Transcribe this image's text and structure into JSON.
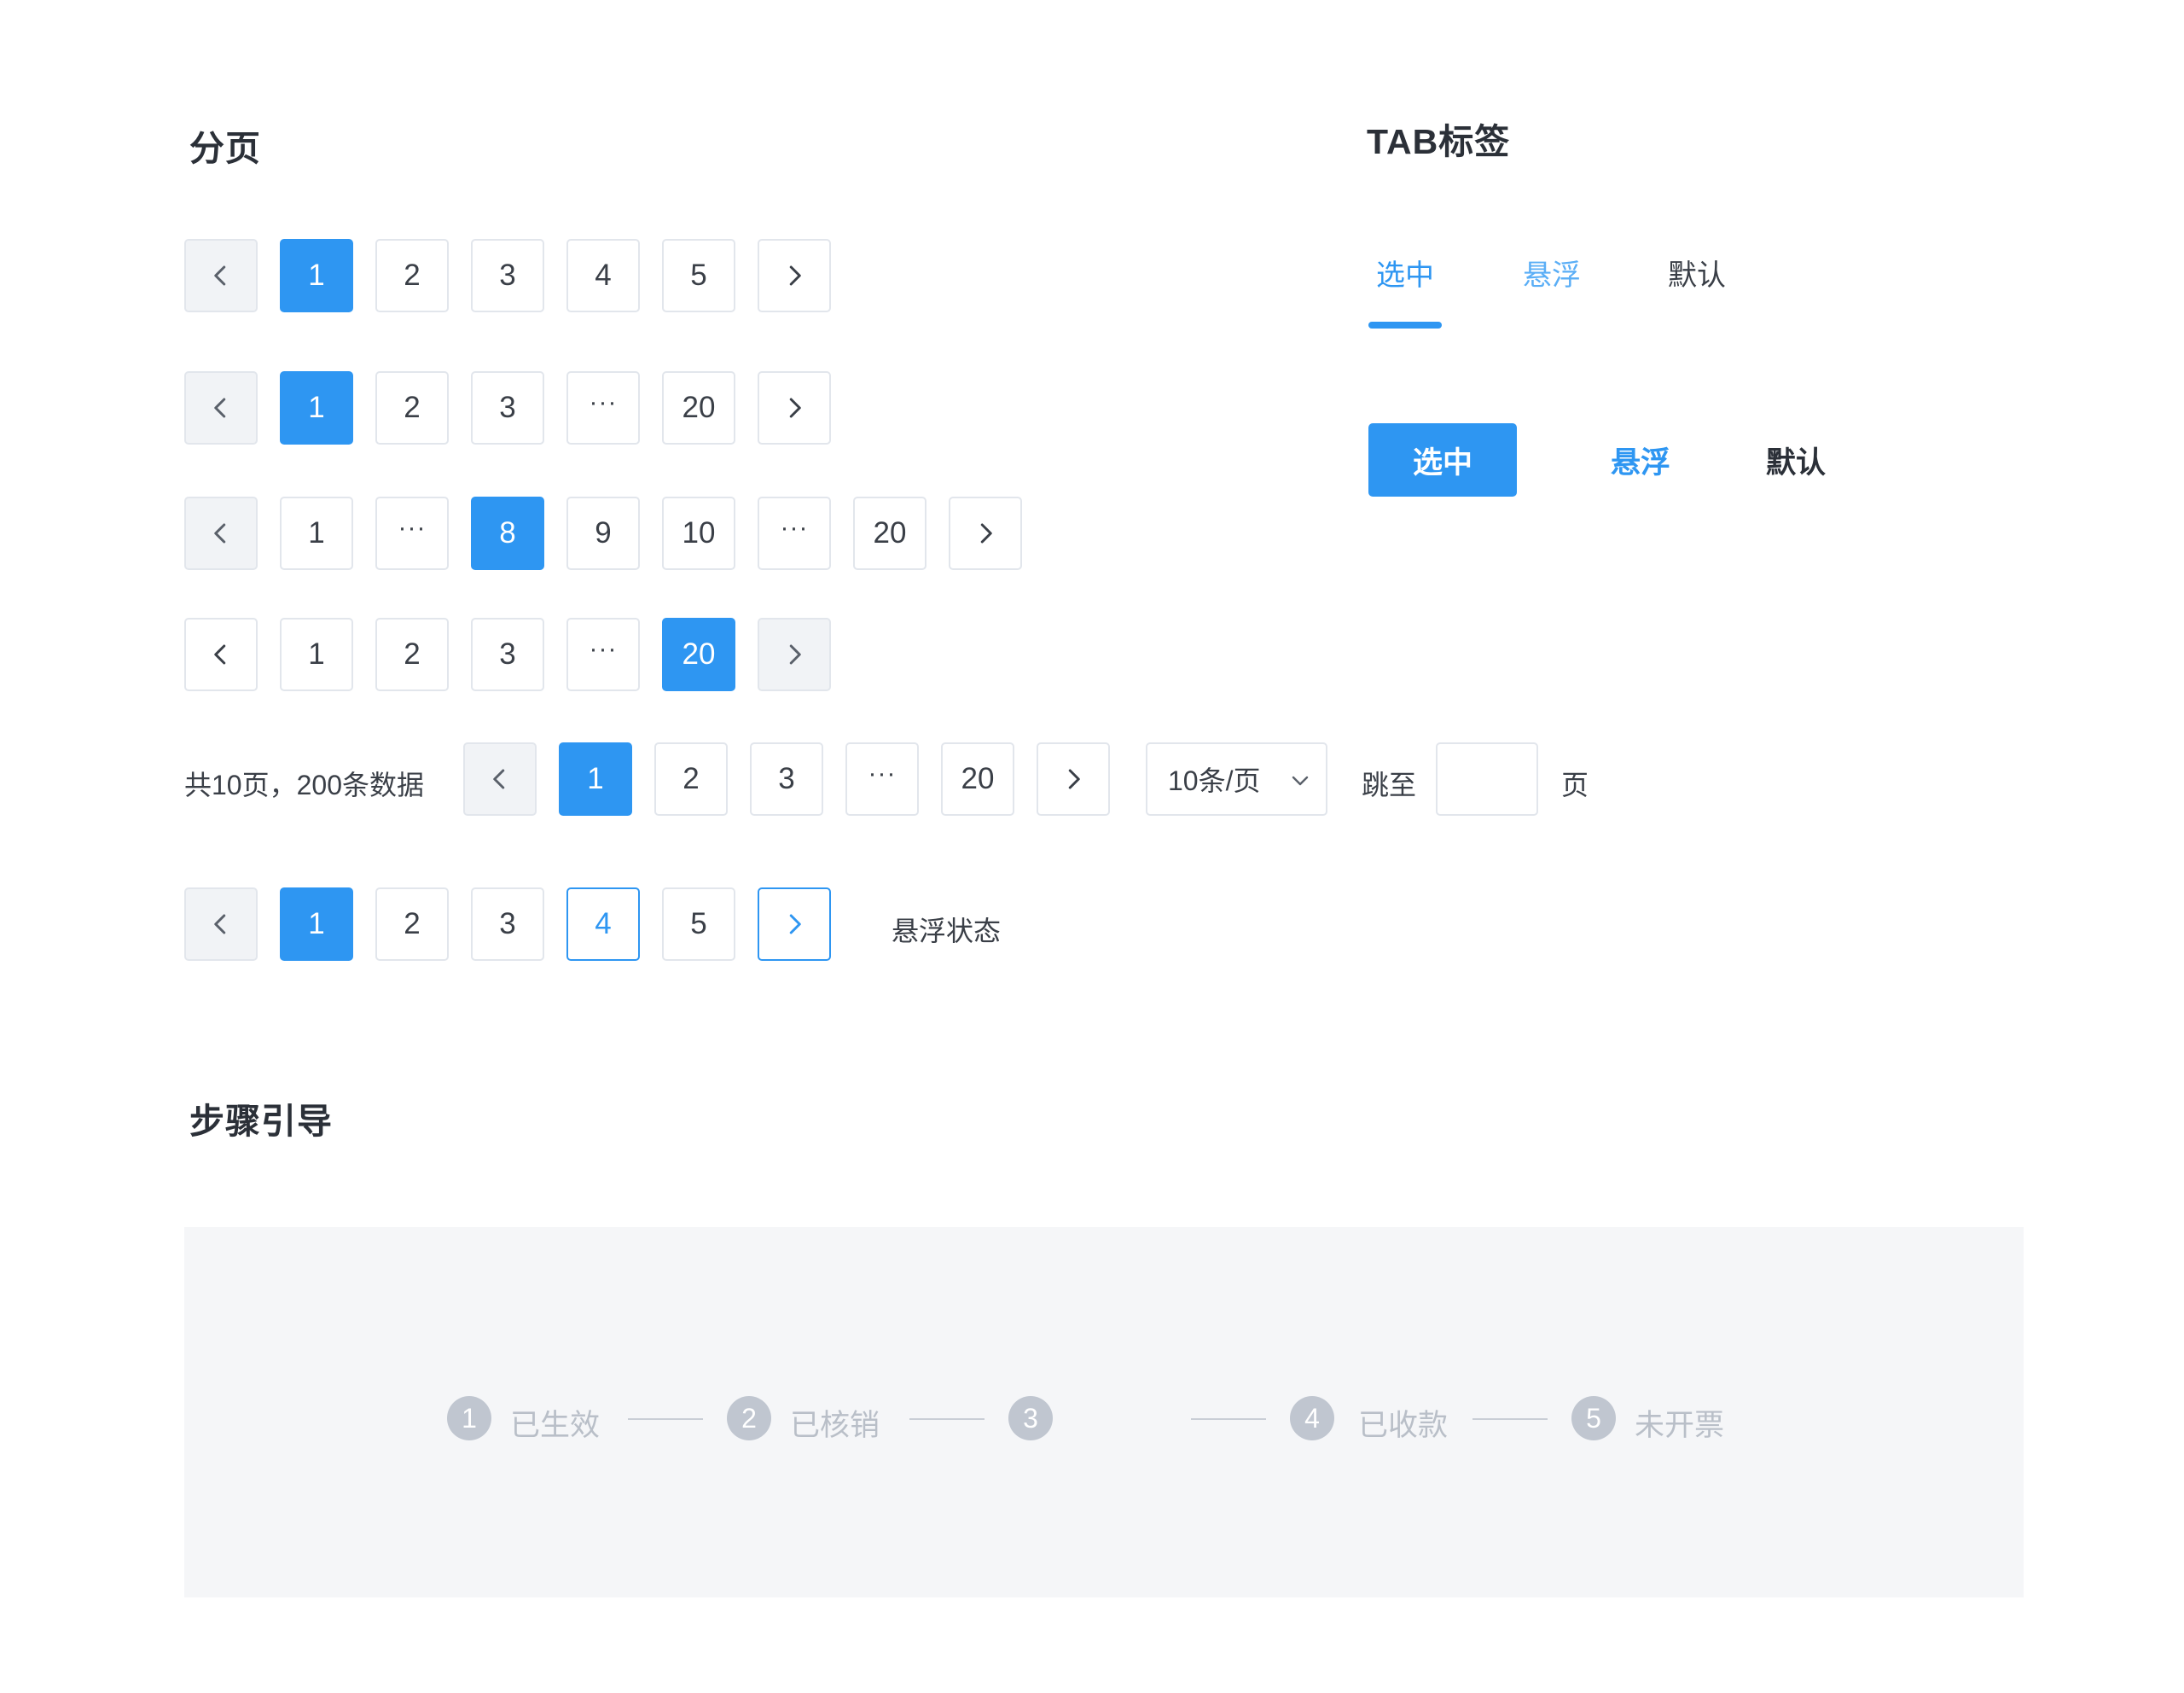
{
  "pagination": {
    "title": "分页",
    "row1": [
      "1",
      "2",
      "3",
      "4",
      "5"
    ],
    "row2": [
      "1",
      "2",
      "3",
      "···",
      "20"
    ],
    "row3": [
      "1",
      "···",
      "8",
      "9",
      "10",
      "···",
      "20"
    ],
    "row4": [
      "1",
      "2",
      "3",
      "···",
      "20"
    ],
    "row5": {
      "summary": "共10页，200条数据",
      "pages": [
        "1",
        "2",
        "3",
        "···",
        "20"
      ],
      "page_size": "10条/页",
      "jump_label": "跳至",
      "jump_value": "",
      "page_suffix": "页"
    },
    "row6": {
      "pages": [
        "1",
        "2",
        "3",
        "4",
        "5"
      ],
      "hover_label": "悬浮状态"
    }
  },
  "tabs": {
    "title": "TAB标签",
    "line_tabs": [
      "选中",
      "悬浮",
      "默认"
    ],
    "button_tabs": [
      "选中",
      "悬浮",
      "默认"
    ]
  },
  "steps": {
    "title": "步骤引导",
    "items": [
      {
        "num": "1",
        "label": "已生效"
      },
      {
        "num": "2",
        "label": "已核销"
      },
      {
        "num": "3",
        "label": ""
      },
      {
        "num": "4",
        "label": "已收款"
      },
      {
        "num": "5",
        "label": "未开票"
      }
    ]
  },
  "colors": {
    "primary": "#2e96f2",
    "border": "#e2e6ec",
    "disabled_bg": "#f1f3f6",
    "step_inactive": "#c0c6d0",
    "panel_bg": "#f5f6f8"
  }
}
